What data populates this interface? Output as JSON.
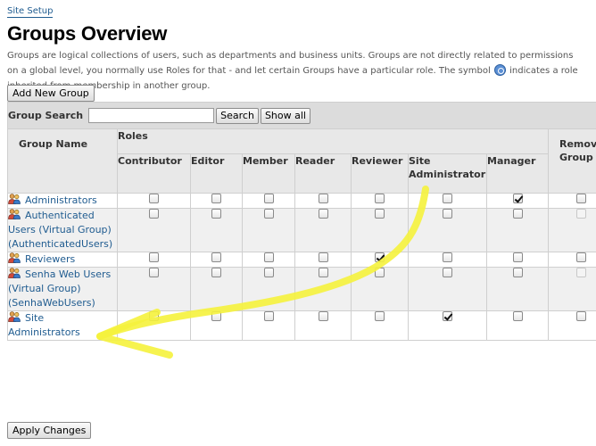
{
  "breadcrumb": "Site Setup",
  "title": "Groups Overview",
  "description_before": "Groups are logical collections of users, such as departments and business units. Groups are not directly related to permissions on a global level, you normally use Roles for that - and let certain Groups have a particular role. The symbol",
  "description_after": "indicates a role inherited from membership in another group.",
  "add_button": "Add New Group",
  "search": {
    "label": "Group Search",
    "value": "",
    "button": "Search",
    "show_all": "Show all"
  },
  "headers": {
    "group_name": "Group Name",
    "roles": "Roles",
    "remove": "Remove Group",
    "roles_list": [
      "Contributor",
      "Editor",
      "Member",
      "Reader",
      "Reviewer",
      "Site Administrator",
      "Manager"
    ]
  },
  "groups": [
    {
      "name": "Administrators",
      "roles": [
        false,
        false,
        false,
        false,
        false,
        false,
        true
      ],
      "removable": true
    },
    {
      "name": "Authenticated Users (Virtual Group) (AuthenticatedUsers)",
      "roles": [
        false,
        false,
        false,
        false,
        false,
        false,
        false
      ],
      "removable": false
    },
    {
      "name": "Reviewers",
      "roles": [
        false,
        false,
        false,
        false,
        true,
        false,
        false
      ],
      "removable": true
    },
    {
      "name": "Senha Web Users (Virtual Group) (SenhaWebUsers)",
      "roles": [
        false,
        false,
        false,
        false,
        false,
        false,
        false
      ],
      "removable": false
    },
    {
      "name": "Site Administrators",
      "roles": [
        false,
        false,
        false,
        false,
        false,
        true,
        false
      ],
      "removable": true
    }
  ],
  "apply_button": "Apply Changes",
  "colors": {
    "link": "#205c90",
    "header_bg": "#e8e8e8",
    "search_bg": "#dcdcdc",
    "annotation": "#f5f23c"
  }
}
